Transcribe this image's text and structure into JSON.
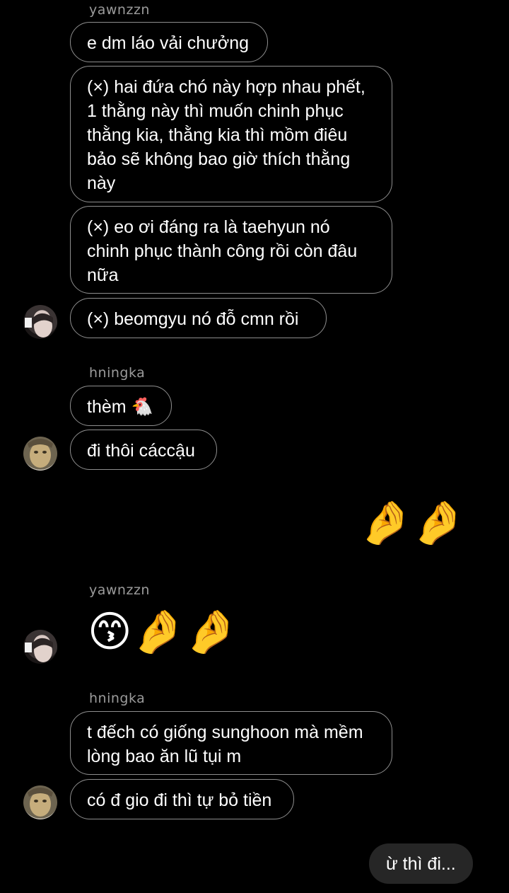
{
  "messages": {
    "sender_1": "yawnzzn",
    "m1": "e dm láo vải chưởng",
    "m2": "(×) hai đứa chó này hợp nhau phết, 1 thằng này thì muốn chinh phục thằng kia, thằng kia thì mồm điêu bảo sẽ không bao giờ thích thằng này",
    "m3": "(×) eo ơi đáng ra là taehyun nó chinh phục thành công rồi còn đâu nữa",
    "m4": "(×) beomgyu nó đỗ cmn rồi",
    "sender_2": "hningka",
    "m5_text": "thèm",
    "m5_emoji": "🐔",
    "m6": "đi thôi cáccậu",
    "mine_emoji": "🤌🤌",
    "sender_3": "yawnzzn",
    "m7_emoji": "😙🤌🤌",
    "sender_4": "hningka",
    "m8": "t đếch có giống sunghoon mà mềm lòng bao ăn lũ tụi m",
    "m9": "có đ gio đi thì tự bỏ tiền",
    "mine_reply": "ừ thì đi..."
  }
}
